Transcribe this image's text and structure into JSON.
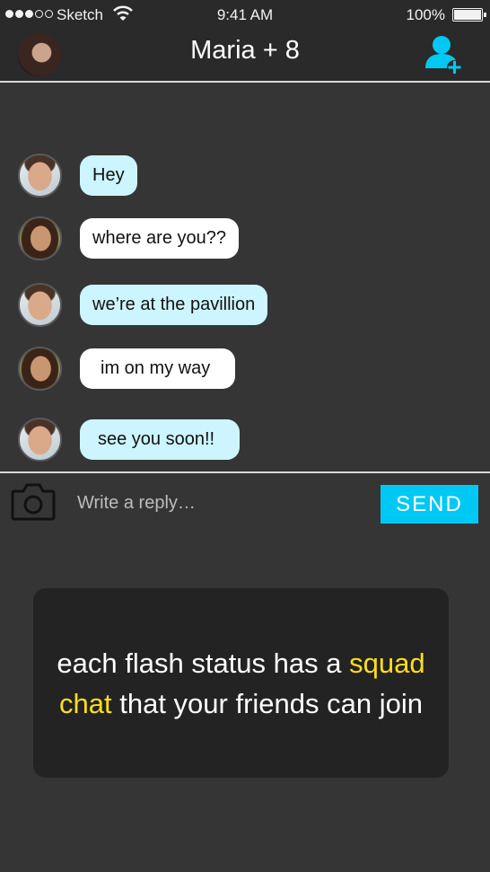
{
  "status_bar": {
    "carrier": "Sketch",
    "time": "9:41 AM",
    "battery": "100%",
    "signal_icon": "signal-dots-icon",
    "wifi_icon": "wifi-icon",
    "battery_icon": "battery-icon"
  },
  "header": {
    "title": "Maria + 8",
    "add_user_icon": "add-user-icon",
    "accent_color": "#00c8f5"
  },
  "messages": [
    {
      "sender": "man",
      "text": "Hey",
      "style": "blue"
    },
    {
      "sender": "woman",
      "text": "where are you??",
      "style": "white"
    },
    {
      "sender": "man",
      "text": "we’re at the pavillion",
      "style": "blue"
    },
    {
      "sender": "woman",
      "text": "im on my way",
      "style": "white"
    },
    {
      "sender": "man",
      "text": "see you soon!!",
      "style": "blue"
    }
  ],
  "reply": {
    "placeholder": "Write a reply…",
    "value": "",
    "send_label": "SEND",
    "camera_icon": "camera-icon"
  },
  "caption": {
    "before": "each flash status has a",
    "highlight": "squad chat",
    "after": "that your friends can join",
    "highlight_color": "#ffdf1c"
  }
}
